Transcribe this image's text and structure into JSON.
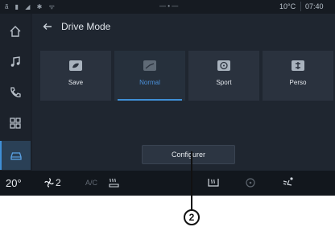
{
  "status_bar": {
    "left_icons": "ã ▮ ◢ ✱ ᯤ",
    "center": "— • —",
    "temperature": "10°C",
    "time": "07:40"
  },
  "sidebar": {
    "items": [
      {
        "icon": "home-icon"
      },
      {
        "icon": "music-icon"
      },
      {
        "icon": "phone-icon"
      },
      {
        "icon": "apps-icon"
      },
      {
        "icon": "car-icon",
        "active": true
      }
    ]
  },
  "page": {
    "title": "Drive Mode"
  },
  "modes": [
    {
      "label": "Save",
      "icon": "eco-icon"
    },
    {
      "label": "Normal",
      "icon": "normal-mode-icon",
      "selected": true
    },
    {
      "label": "Sport",
      "icon": "steering-wheel-icon"
    },
    {
      "label": "Perso",
      "icon": "perso-mode-icon"
    }
  ],
  "configure_label": "Configurer",
  "climate": {
    "temperature": "20°",
    "fan_level": "2",
    "ac_label": "A/C"
  },
  "callout_number": "2",
  "colors": {
    "accent": "#3f8fd6",
    "screen_bg": "#1a2029",
    "card_bg": "#2a323e"
  }
}
